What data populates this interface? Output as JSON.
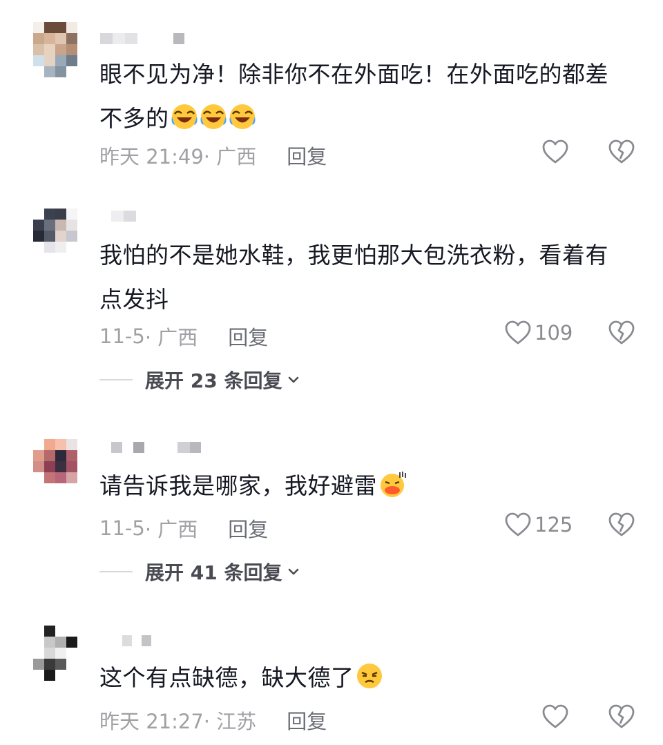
{
  "comments": [
    {
      "text_line1": "眼不见为净！除非你不在外面吃！在外面吃的都差",
      "text_line2": "不多的",
      "emoji": "laughing-crying-emoji",
      "time": "昨天 21:49",
      "location": "· 广西",
      "reply_label": "回复",
      "likes": ""
    },
    {
      "text_line1": "我怕的不是她水鞋，我更怕那大包洗衣粉，看着有",
      "text_line2": "点发抖",
      "time": "11-5",
      "location": "· 广西",
      "reply_label": "回复",
      "likes": "109",
      "expand": "展开 23 条回复"
    },
    {
      "text_line1": "请告诉我是哪家，我好避雷",
      "emoji": "sweating-duck-lips-emoji",
      "time": "11-5",
      "location": "· 广西",
      "reply_label": "回复",
      "likes": "125",
      "expand": "展开 41 条回复"
    },
    {
      "text_line1": "这个有点缺德，缺大德了",
      "emoji": "annoyed-face-emoji",
      "time": "昨天 21:27",
      "location": "· 江苏",
      "reply_label": "回复",
      "likes": ""
    }
  ],
  "colors": {
    "text": "#161823",
    "meta": "#a0a0a5",
    "reply": "#6b6d75",
    "icon": "#8a8b91"
  }
}
